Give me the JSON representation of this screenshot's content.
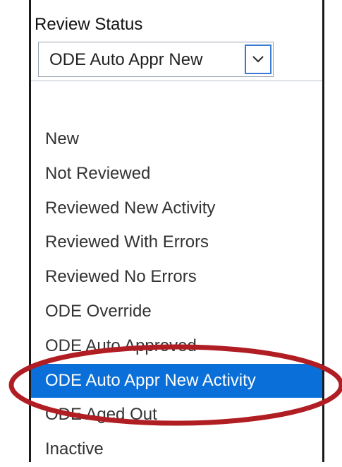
{
  "review_status": {
    "label": "Review Status",
    "selected_value": "ODE Auto Appr New",
    "options": [
      {
        "label": "New"
      },
      {
        "label": "Not Reviewed"
      },
      {
        "label": "Reviewed New Activity"
      },
      {
        "label": "Reviewed With Errors"
      },
      {
        "label": "Reviewed No Errors"
      },
      {
        "label": "ODE Override"
      },
      {
        "label": "ODE Auto Approved"
      },
      {
        "label": "ODE Auto Appr New Activity",
        "selected": true
      },
      {
        "label": "ODE Aged Out"
      },
      {
        "label": "Inactive"
      }
    ],
    "arrow_icon": "chevron-down-icon"
  },
  "colors": {
    "selected_background": "#0a6fd8",
    "annotation_ellipse": "#b01e24",
    "frame_border": "#1a1a1a"
  }
}
